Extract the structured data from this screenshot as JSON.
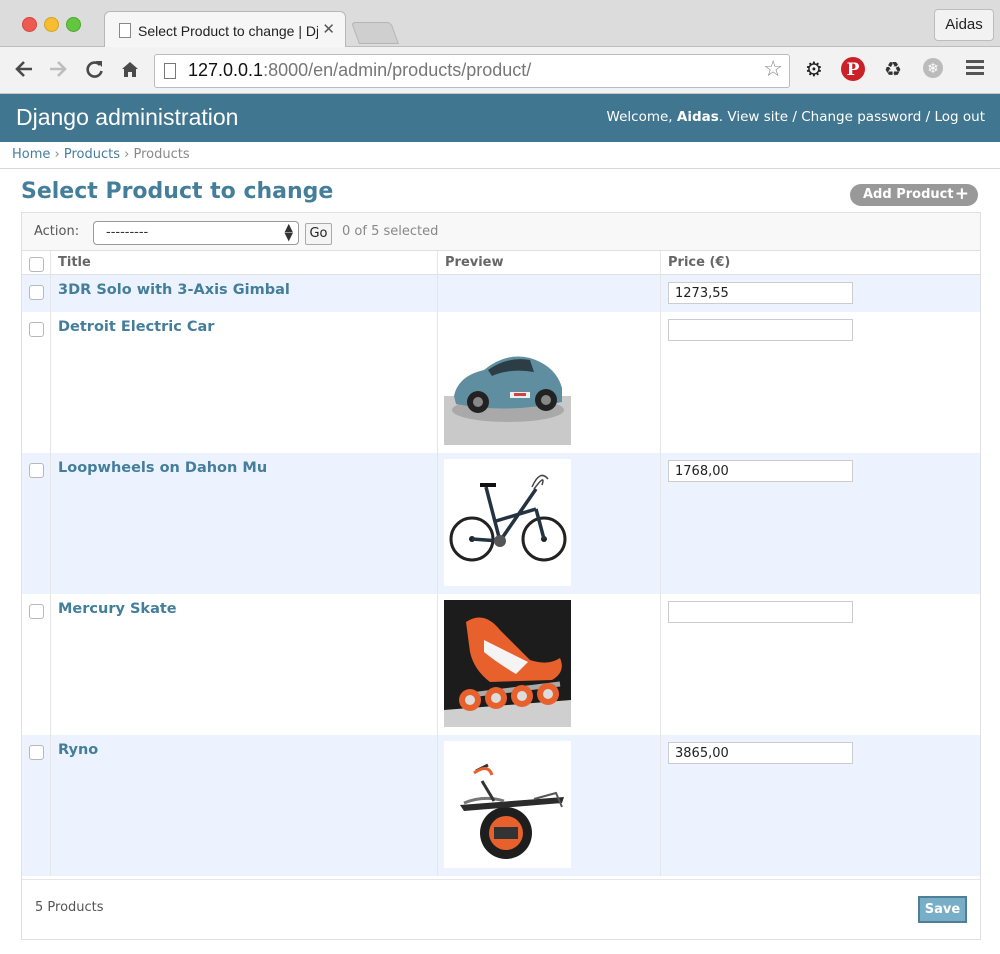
{
  "browser": {
    "tab_title": "Select Product to change | Django site admin",
    "profile_name": "Aidas",
    "url_host": "127.0.0.1",
    "url_rest": ":8000/en/admin/products/product/"
  },
  "admin": {
    "brand": "Django administration",
    "welcome": "Welcome,",
    "username": "Aidas",
    "view_site": "View site",
    "change_password": "Change password",
    "log_out": "Log out",
    "separator": "/"
  },
  "breadcrumbs": [
    "Home",
    "Products",
    "Products"
  ],
  "page_title": "Select Product to change",
  "add_button": "Add Product",
  "actions": {
    "label": "Action:",
    "selected_option": "---------",
    "go": "Go",
    "selection_count": "0 of 5 selected"
  },
  "columns": {
    "title": "Title",
    "preview": "Preview",
    "price": "Price (€)"
  },
  "rows": [
    {
      "title": "3DR Solo with 3-Axis Gimbal",
      "price": "1273,55",
      "preview": "none"
    },
    {
      "title": "Detroit Electric Car",
      "price": "",
      "preview": "car"
    },
    {
      "title": "Loopwheels on Dahon Mu",
      "price": "1768,00",
      "preview": "bicycle"
    },
    {
      "title": "Mercury Skate",
      "price": "",
      "preview": "skate"
    },
    {
      "title": "Ryno",
      "price": "3865,00",
      "preview": "unicycle"
    }
  ],
  "footer": {
    "count": "5 Products",
    "save": "Save"
  },
  "colors": {
    "header": "#417690",
    "link": "#447e9b",
    "row_alt": "#edf3fe",
    "save_button": "#79aec8"
  }
}
